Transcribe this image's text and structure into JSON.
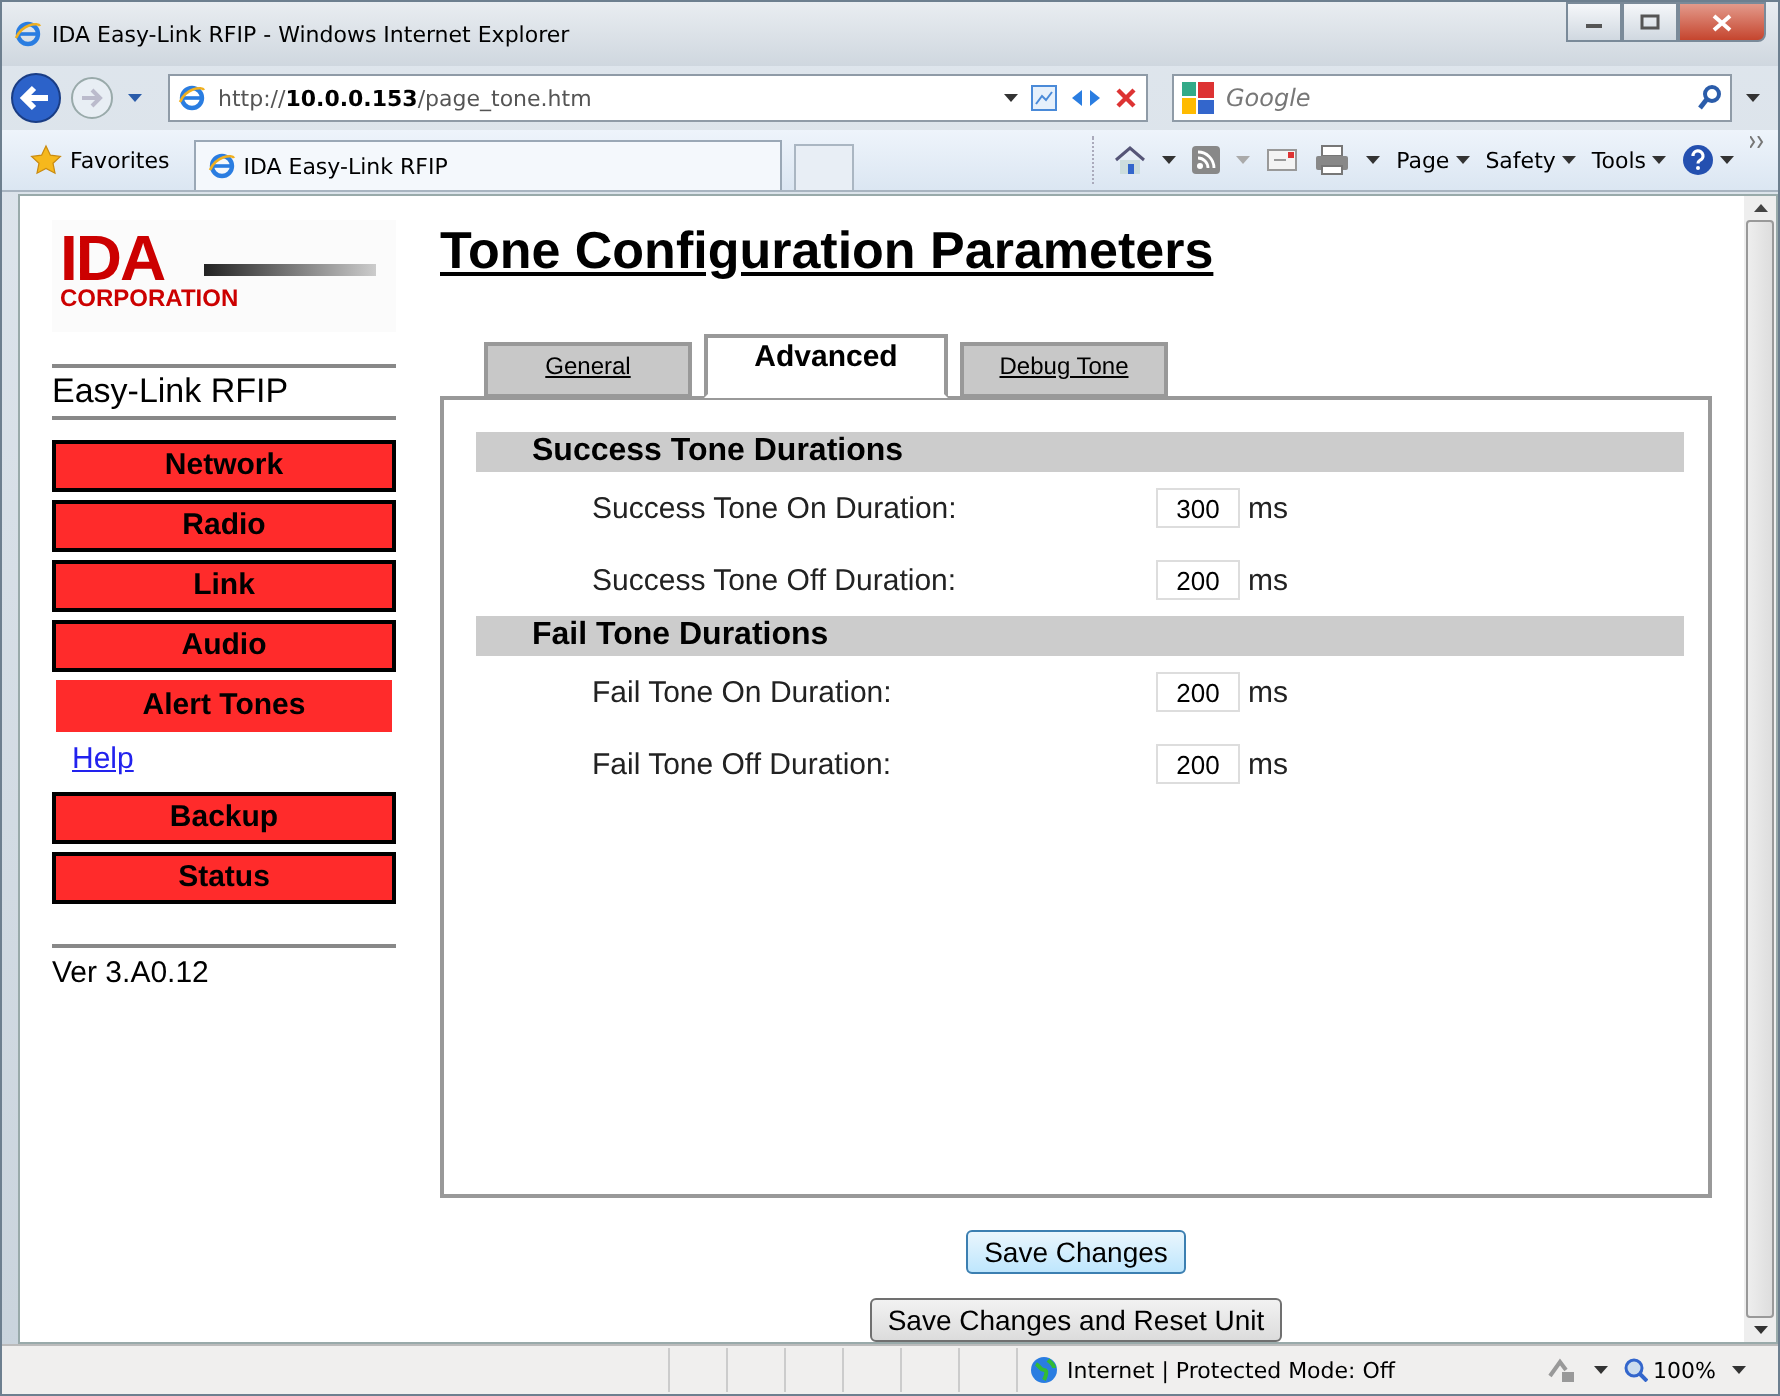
{
  "window": {
    "title": "IDA Easy-Link RFIP - Windows Internet Explorer"
  },
  "address_bar": {
    "url_prefix": "http://",
    "url_host": "10.0.0.153",
    "url_path": "/page_tone.htm"
  },
  "search": {
    "placeholder": "Google"
  },
  "favorites_bar": {
    "favorites": "Favorites",
    "tabs": [
      {
        "label": "IDA Easy-Link RFIP",
        "selected": true
      }
    ]
  },
  "command_bar": {
    "menus": [
      "Page",
      "Safety",
      "Tools"
    ]
  },
  "sidebar": {
    "logo": {
      "top": "IDA",
      "bottom": "CORPORATION"
    },
    "product": "Easy-Link RFIP",
    "items": [
      {
        "label": "Network",
        "kind": "button",
        "selected": false
      },
      {
        "label": "Radio",
        "kind": "button",
        "selected": false
      },
      {
        "label": "Link",
        "kind": "button",
        "selected": false
      },
      {
        "label": "Audio",
        "kind": "button",
        "selected": false
      },
      {
        "label": "Alert Tones",
        "kind": "button",
        "selected": true
      },
      {
        "label": "Help",
        "kind": "link",
        "selected": false
      },
      {
        "label": "Backup",
        "kind": "button",
        "selected": false
      },
      {
        "label": "Status",
        "kind": "button",
        "selected": false
      }
    ],
    "version": "Ver 3.A0.12"
  },
  "page": {
    "title": "Tone Configuration Parameters",
    "tabs": [
      {
        "label": "General",
        "selected": false
      },
      {
        "label": "Advanced",
        "selected": true
      },
      {
        "label": "Debug Tone",
        "selected": false
      }
    ],
    "sections": [
      {
        "heading": "Success Tone Durations",
        "fields": [
          {
            "label": "Success Tone On Duration:",
            "value": "300",
            "unit": "ms"
          },
          {
            "label": "Success Tone Off Duration:",
            "value": "200",
            "unit": "ms"
          }
        ]
      },
      {
        "heading": "Fail Tone Durations",
        "fields": [
          {
            "label": "Fail Tone On Duration:",
            "value": "200",
            "unit": "ms"
          },
          {
            "label": "Fail Tone Off Duration:",
            "value": "200",
            "unit": "ms"
          }
        ]
      }
    ],
    "buttons": [
      "Save Changes",
      "Save Changes and Reset Unit"
    ]
  },
  "status_bar": {
    "zone": "Internet | Protected Mode: Off",
    "zoom": "100%"
  }
}
